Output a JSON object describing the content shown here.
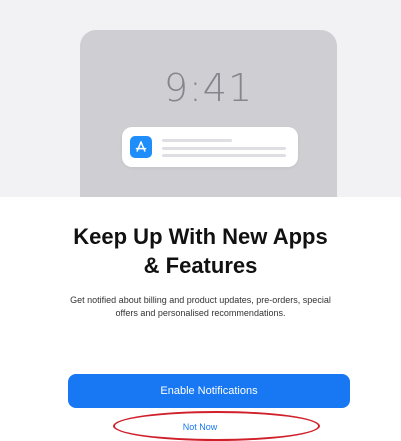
{
  "hero": {
    "lock_time": "9:41",
    "app_icon": "app-store-icon",
    "app_icon_color": "#1f8efa"
  },
  "content": {
    "title_line1": "Keep Up With New Apps",
    "title_line2": "& Features",
    "subtitle": "Get notified about billing and product updates, pre-orders, special offers and personalised recommendations."
  },
  "actions": {
    "enable_label": "Enable Notifications",
    "not_now_label": "Not Now"
  },
  "colors": {
    "accent": "#1877f2",
    "annotation": "#d0202b"
  }
}
